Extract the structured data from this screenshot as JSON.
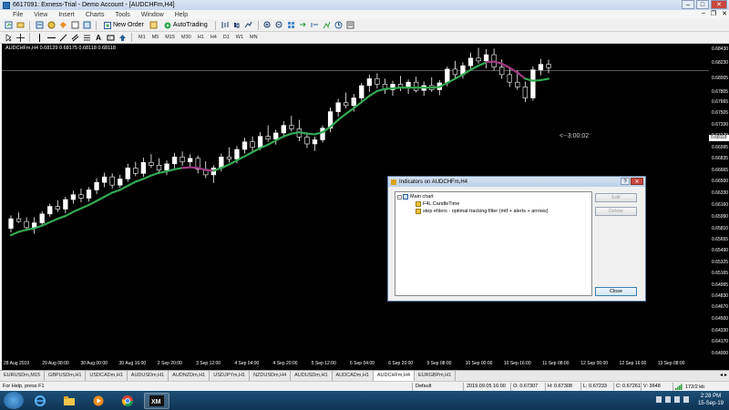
{
  "window": {
    "title": "6617091: Exness-Trial - Demo Account - [AUDCHFm,H4]",
    "minimize": "–",
    "maximize": "□",
    "close": "✕"
  },
  "menu": [
    "File",
    "View",
    "Insert",
    "Charts",
    "Tools",
    "Window",
    "Help"
  ],
  "mdi_controls": {
    "minimize": "–",
    "restore": "❐",
    "close": "✕"
  },
  "toolbar": {
    "new_order_label": "New Order",
    "autotrading_label": "AutoTrading",
    "timeframes": [
      "M1",
      "M5",
      "M15",
      "M30",
      "H1",
      "H4",
      "D1",
      "W1",
      "MN"
    ]
  },
  "chart": {
    "title": "AUDCHFm,H4  0.68129 0.68175 0.68118 0.68118",
    "current_price": "0.68118",
    "candle_timer": "<--3:00:02",
    "colors": {
      "bull": "#ffffff",
      "bear": "#000000",
      "wick": "#ffffff",
      "filter_up": "#34a853",
      "filter_down": "#a03c84"
    },
    "price_labels": [
      "0.68430",
      "0.68230",
      "0.68118",
      "0.68005",
      "0.67805",
      "0.67665",
      "0.67505",
      "0.67330",
      "0.67170",
      "0.66995",
      "0.66835",
      "0.66665",
      "0.66500",
      "0.66330",
      "0.66160",
      "0.65990",
      "0.65810",
      "0.65655",
      "0.65490",
      "0.65325",
      "0.65165",
      "0.64995",
      "0.64830",
      "0.64670",
      "0.64500",
      "0.64330",
      "0.64170",
      "0.64000"
    ],
    "time_labels": [
      "28 Aug 2019",
      "29 Aug 08:00",
      "30 Aug 00:00",
      "30 Aug 16:00",
      "2 Sep 20:00",
      "3 Sep 12:00",
      "4 Sep 04:00",
      "4 Sep 20:00",
      "5 Sep 12:00",
      "6 Sep 04:00",
      "6 Sep 20:00",
      "9 Sep 08:00",
      "10 Sep 00:00",
      "10 Sep 16:00",
      "11 Sep 08:00",
      "12 Sep 00:00",
      "12 Sep 16:00",
      "13 Sep 08:00"
    ]
  },
  "chart_data": {
    "type": "candlestick",
    "symbol": "AUDCHFm",
    "timeframe": "H4",
    "ylim": [
      0.6393,
      0.6851
    ],
    "candles": [
      [
        0.6582,
        0.6601,
        0.6576,
        0.6596
      ],
      [
        0.6596,
        0.6605,
        0.659,
        0.6592
      ],
      [
        0.6592,
        0.6598,
        0.6578,
        0.6583
      ],
      [
        0.6583,
        0.6598,
        0.6574,
        0.659
      ],
      [
        0.659,
        0.6607,
        0.6585,
        0.6603
      ],
      [
        0.6603,
        0.6618,
        0.6599,
        0.6614
      ],
      [
        0.6614,
        0.6623,
        0.6606,
        0.661
      ],
      [
        0.661,
        0.6628,
        0.6604,
        0.6624
      ],
      [
        0.6624,
        0.6637,
        0.6618,
        0.6631
      ],
      [
        0.6631,
        0.664,
        0.662,
        0.6626
      ],
      [
        0.6626,
        0.6642,
        0.6621,
        0.6638
      ],
      [
        0.6638,
        0.6655,
        0.6632,
        0.6649
      ],
      [
        0.6649,
        0.6663,
        0.6642,
        0.6657
      ],
      [
        0.6657,
        0.6662,
        0.664,
        0.6645
      ],
      [
        0.6645,
        0.666,
        0.6641,
        0.6654
      ],
      [
        0.6654,
        0.6676,
        0.665,
        0.667
      ],
      [
        0.667,
        0.6679,
        0.6658,
        0.6662
      ],
      [
        0.6662,
        0.6685,
        0.6657,
        0.6678
      ],
      [
        0.6678,
        0.669,
        0.667,
        0.6674
      ],
      [
        0.6674,
        0.6684,
        0.6661,
        0.6667
      ],
      [
        0.6667,
        0.6681,
        0.666,
        0.6676
      ],
      [
        0.6676,
        0.6692,
        0.6668,
        0.6686
      ],
      [
        0.6686,
        0.6694,
        0.6673,
        0.6679
      ],
      [
        0.6679,
        0.669,
        0.667,
        0.6684
      ],
      [
        0.6684,
        0.6688,
        0.6662,
        0.6668
      ],
      [
        0.6668,
        0.668,
        0.6655,
        0.666
      ],
      [
        0.666,
        0.6674,
        0.6648,
        0.667
      ],
      [
        0.667,
        0.6691,
        0.6665,
        0.6686
      ],
      [
        0.6686,
        0.67,
        0.6678,
        0.6683
      ],
      [
        0.6683,
        0.6702,
        0.6677,
        0.6697
      ],
      [
        0.6697,
        0.6714,
        0.6691,
        0.6708
      ],
      [
        0.6708,
        0.6716,
        0.6694,
        0.67
      ],
      [
        0.67,
        0.6722,
        0.6696,
        0.6716
      ],
      [
        0.6716,
        0.6732,
        0.6708,
        0.6712
      ],
      [
        0.6712,
        0.6726,
        0.6704,
        0.6721
      ],
      [
        0.6721,
        0.6738,
        0.6714,
        0.6732
      ],
      [
        0.6732,
        0.6746,
        0.6723,
        0.6727
      ],
      [
        0.6727,
        0.674,
        0.6709,
        0.6715
      ],
      [
        0.6715,
        0.6722,
        0.6699,
        0.6705
      ],
      [
        0.6705,
        0.6716,
        0.6695,
        0.6711
      ],
      [
        0.6711,
        0.6732,
        0.6707,
        0.6728
      ],
      [
        0.6728,
        0.6758,
        0.6722,
        0.6752
      ],
      [
        0.6752,
        0.6771,
        0.6745,
        0.6765
      ],
      [
        0.6765,
        0.678,
        0.6757,
        0.6761
      ],
      [
        0.6761,
        0.6778,
        0.6752,
        0.6772
      ],
      [
        0.6772,
        0.6794,
        0.6768,
        0.679
      ],
      [
        0.679,
        0.6806,
        0.6781,
        0.68
      ],
      [
        0.68,
        0.6808,
        0.6786,
        0.6792
      ],
      [
        0.6792,
        0.68,
        0.6778,
        0.6784
      ],
      [
        0.6784,
        0.6797,
        0.6775,
        0.6792
      ],
      [
        0.6792,
        0.6804,
        0.6782,
        0.6787
      ],
      [
        0.6787,
        0.6799,
        0.6778,
        0.6795
      ],
      [
        0.6795,
        0.6803,
        0.678,
        0.6783
      ],
      [
        0.6783,
        0.6796,
        0.6775,
        0.679
      ],
      [
        0.679,
        0.6802,
        0.6781,
        0.6784
      ],
      [
        0.6784,
        0.6798,
        0.6776,
        0.6794
      ],
      [
        0.6794,
        0.6818,
        0.6789,
        0.6814
      ],
      [
        0.6814,
        0.6826,
        0.68,
        0.6806
      ],
      [
        0.6806,
        0.6824,
        0.68,
        0.6819
      ],
      [
        0.6819,
        0.6838,
        0.6812,
        0.683
      ],
      [
        0.683,
        0.6845,
        0.6822,
        0.6826
      ],
      [
        0.6826,
        0.6843,
        0.6815,
        0.6835
      ],
      [
        0.6835,
        0.6844,
        0.6812,
        0.6817
      ],
      [
        0.6817,
        0.6828,
        0.68,
        0.6806
      ],
      [
        0.6806,
        0.6816,
        0.6788,
        0.6795
      ],
      [
        0.6795,
        0.6812,
        0.6784,
        0.6788
      ],
      [
        0.6788,
        0.6796,
        0.6766,
        0.6772
      ],
      [
        0.6772,
        0.6818,
        0.6768,
        0.6813
      ],
      [
        0.6813,
        0.6829,
        0.6805,
        0.6821
      ],
      [
        0.6821,
        0.6828,
        0.6808,
        0.6816
      ]
    ],
    "filter": {
      "name": "step ehlers - optimal tracking filter (mtf + alerts + arrows)",
      "values": [
        0.6572,
        0.6577,
        0.658,
        0.6582,
        0.6586,
        0.6591,
        0.6596,
        0.66,
        0.6606,
        0.6611,
        0.6616,
        0.6622,
        0.6628,
        0.6634,
        0.6638,
        0.6644,
        0.665,
        0.6654,
        0.6659,
        0.6663,
        0.6665,
        0.6668,
        0.667,
        0.6671,
        0.667,
        0.6667,
        0.6666,
        0.667,
        0.6675,
        0.6681,
        0.6687,
        0.6693,
        0.6699,
        0.6704,
        0.671,
        0.6716,
        0.672,
        0.6722,
        0.672,
        0.6719,
        0.6722,
        0.673,
        0.674,
        0.6749,
        0.6757,
        0.6766,
        0.6775,
        0.6782,
        0.6785,
        0.6786,
        0.6787,
        0.6787,
        0.6787,
        0.6787,
        0.6787,
        0.6788,
        0.6794,
        0.68,
        0.6806,
        0.6813,
        0.6819,
        0.6824,
        0.6825,
        0.6822,
        0.6816,
        0.6809,
        0.68,
        0.6797,
        0.6798,
        0.68
      ],
      "down_segments": [
        [
          22,
          26
        ],
        [
          61,
          66
        ]
      ]
    }
  },
  "dialog": {
    "title": "Indicators on AUDCHFm,H4",
    "help": "?",
    "close": "✕",
    "tree": {
      "root": "Main chart",
      "items": [
        "F4L CandleTime",
        "step ehlers - optimal tracking filter (mtf + alerts + arrows)"
      ]
    },
    "buttons": {
      "edit": "Edit",
      "delete": "Delete",
      "close": "Close"
    }
  },
  "tabs": {
    "items": [
      "EURUSDm,M15",
      "GBPUSDm,H1",
      "USDCADm,H1",
      "AUDUSDm,H1",
      "AUDNZDm,H1",
      "USDJPYm,H1",
      "NZDUSDm,H4",
      "AUDUSDm,H1",
      "AUDCADm,H1",
      "AUDCHFm,H4",
      "EURGBPm,H1"
    ],
    "active_index": 9
  },
  "status": {
    "help": "For Help, press F1",
    "profile": "Default",
    "time": "2019.09.05 16:00",
    "open": "O: 0.67307",
    "high": "H: 0.67308",
    "low": "L: 0.67233",
    "close": "C: 0.67261",
    "volume": "V: 3648",
    "traffic": "172/2 kb"
  },
  "taskbar": {
    "time": "2:28 PM",
    "date": "15-Sep-19",
    "apps": [
      "internet-explorer",
      "file-explorer",
      "media-player",
      "chrome",
      "xm-terminal"
    ]
  }
}
